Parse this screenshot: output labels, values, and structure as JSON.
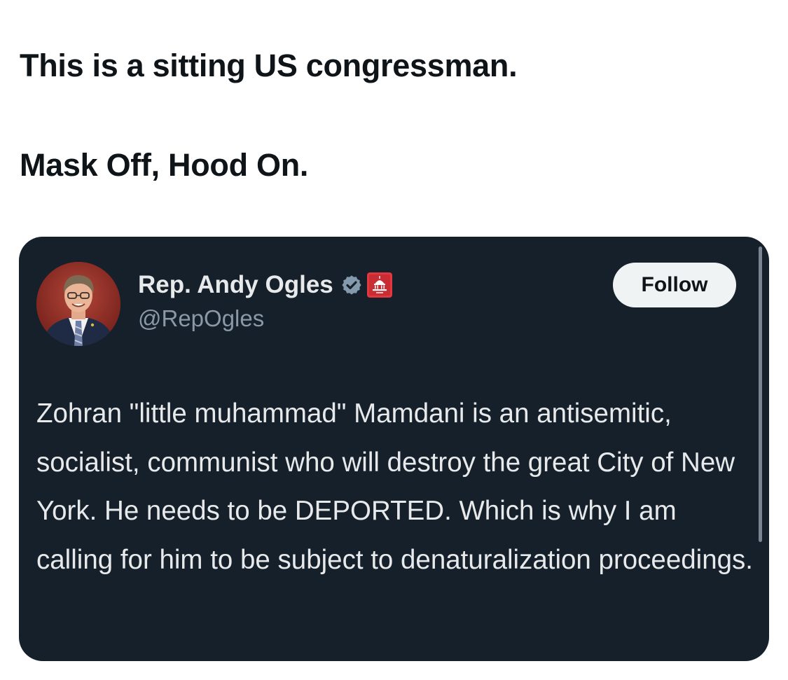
{
  "caption": {
    "line1": "This is a sitting US congressman.",
    "line2": "Mask Off, Hood On."
  },
  "post": {
    "display_name": "Rep. Andy Ogles",
    "handle": "@RepOgles",
    "follow_label": "Follow",
    "badges": [
      "verified-icon",
      "government-affiliate-icon"
    ],
    "text": "Zohran \"little muhammad\" Mamdani is an antisemitic, socialist, communist who will destroy the great City of New York. He needs to be DEPORTED. Which is why I am calling for him to be subject to denaturalization proceedings."
  },
  "theme": {
    "card_background": "#15202b",
    "primary_text": "#e7e9ea",
    "secondary_text": "#8b98a5",
    "verified_badge": "#829aab",
    "affiliate_badge": "#e0383e",
    "follow_button_bg": "#eff3f4"
  }
}
